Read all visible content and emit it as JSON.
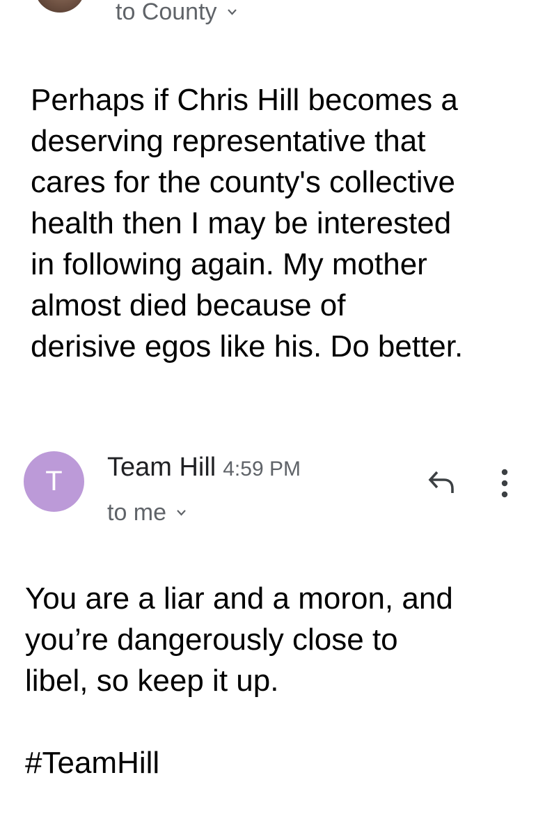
{
  "previous_message": {
    "recipient": "to County",
    "body": "Perhaps if Chris Hill becomes a\ndeserving representative that\ncares for the county's collective\nhealth then I may be interested\nin following again. My mother\nalmost died because of\nderisive egos like his. Do better."
  },
  "reply_message": {
    "avatar_letter": "T",
    "sender": "Team Hill",
    "time": "4:59 PM",
    "recipient": "to me",
    "body": "You are a liar and a moron, and\nyou’re dangerously close to\nlibel, so keep it up.\n\n#TeamHill"
  },
  "icons": {
    "recipient_expand": "chevron-down-icon",
    "reply": "reply-icon",
    "more": "more-vert-icon"
  },
  "colors": {
    "avatar_bg": "#bc9ad8",
    "secondary_text": "#5f6368"
  }
}
